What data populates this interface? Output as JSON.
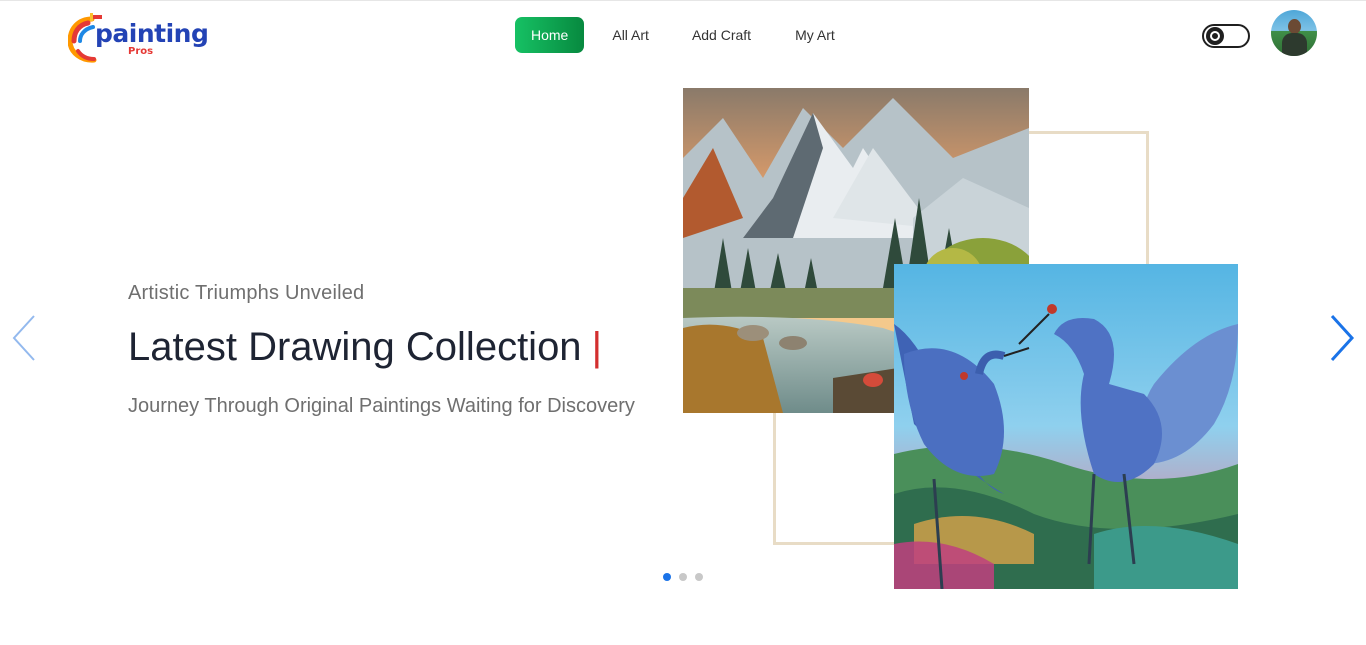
{
  "brand": {
    "name": "painting",
    "sub": "Pros"
  },
  "nav": {
    "links": [
      {
        "label": "Home",
        "active": true
      },
      {
        "label": "All Art",
        "active": false
      },
      {
        "label": "Add Craft",
        "active": false
      },
      {
        "label": "My Art",
        "active": false
      }
    ]
  },
  "theme_toggle": {
    "state": "light"
  },
  "hero": {
    "eyebrow": "Artistic Triumphs Unveiled",
    "headline": "Latest Drawing Collection",
    "cursor": "|",
    "subline": "Journey Through Original Paintings Waiting for Discovery"
  },
  "slider": {
    "slides": 3,
    "active_slide": 1,
    "prev_icon": "chevron-left-icon",
    "next_icon": "chevron-right-icon"
  },
  "colors": {
    "primary_button": "#16c164",
    "accent_blue": "#1a73e8",
    "cursor_red": "#d32f2f",
    "frame": "#e8dcc6"
  }
}
